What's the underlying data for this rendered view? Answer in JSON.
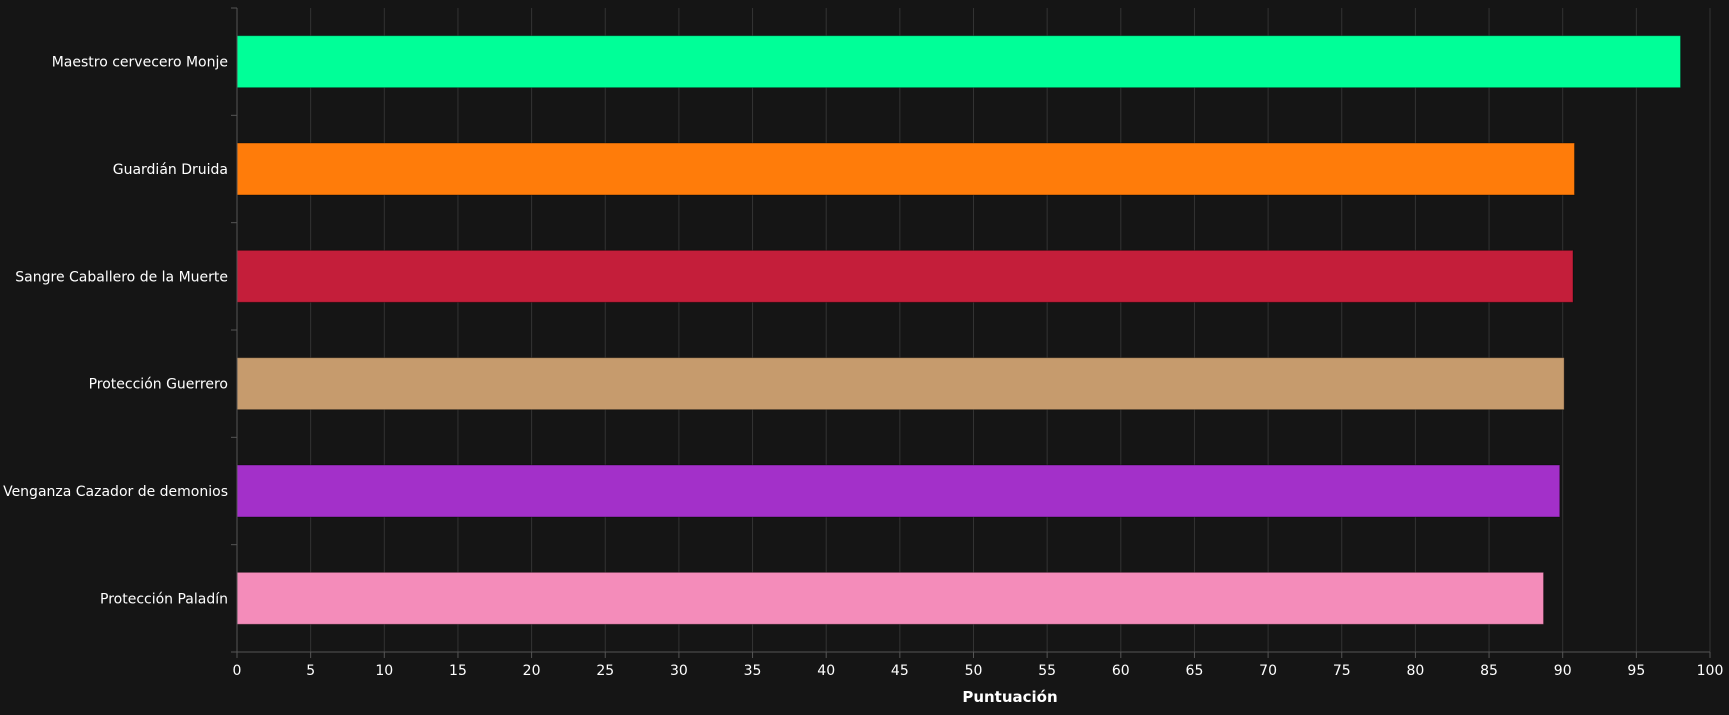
{
  "chart_data": {
    "type": "bar",
    "orientation": "horizontal",
    "categories": [
      "Maestro cervecero Monje",
      "Guardián Druida",
      "Sangre Caballero de la Muerte",
      "Protección Guerrero",
      "Venganza Cazador de demonios",
      "Protección Paladín"
    ],
    "values": [
      98.0,
      90.8,
      90.7,
      90.1,
      89.8,
      88.7
    ],
    "colors": [
      "#00ff98",
      "#ff7c0a",
      "#c41e3a",
      "#c69b6d",
      "#a330c9",
      "#f48cba"
    ],
    "xlabel": "Puntuación",
    "ylabel": "",
    "xlim": [
      0,
      100
    ],
    "xticks": [
      0,
      5,
      10,
      15,
      20,
      25,
      30,
      35,
      40,
      45,
      50,
      55,
      60,
      65,
      70,
      75,
      80,
      85,
      90,
      95,
      100
    ],
    "grid": "vertical",
    "legend": "none"
  },
  "theme": {
    "background": "#151515",
    "text": "#ffffff",
    "grid": "#333333",
    "axis": "#555555"
  }
}
